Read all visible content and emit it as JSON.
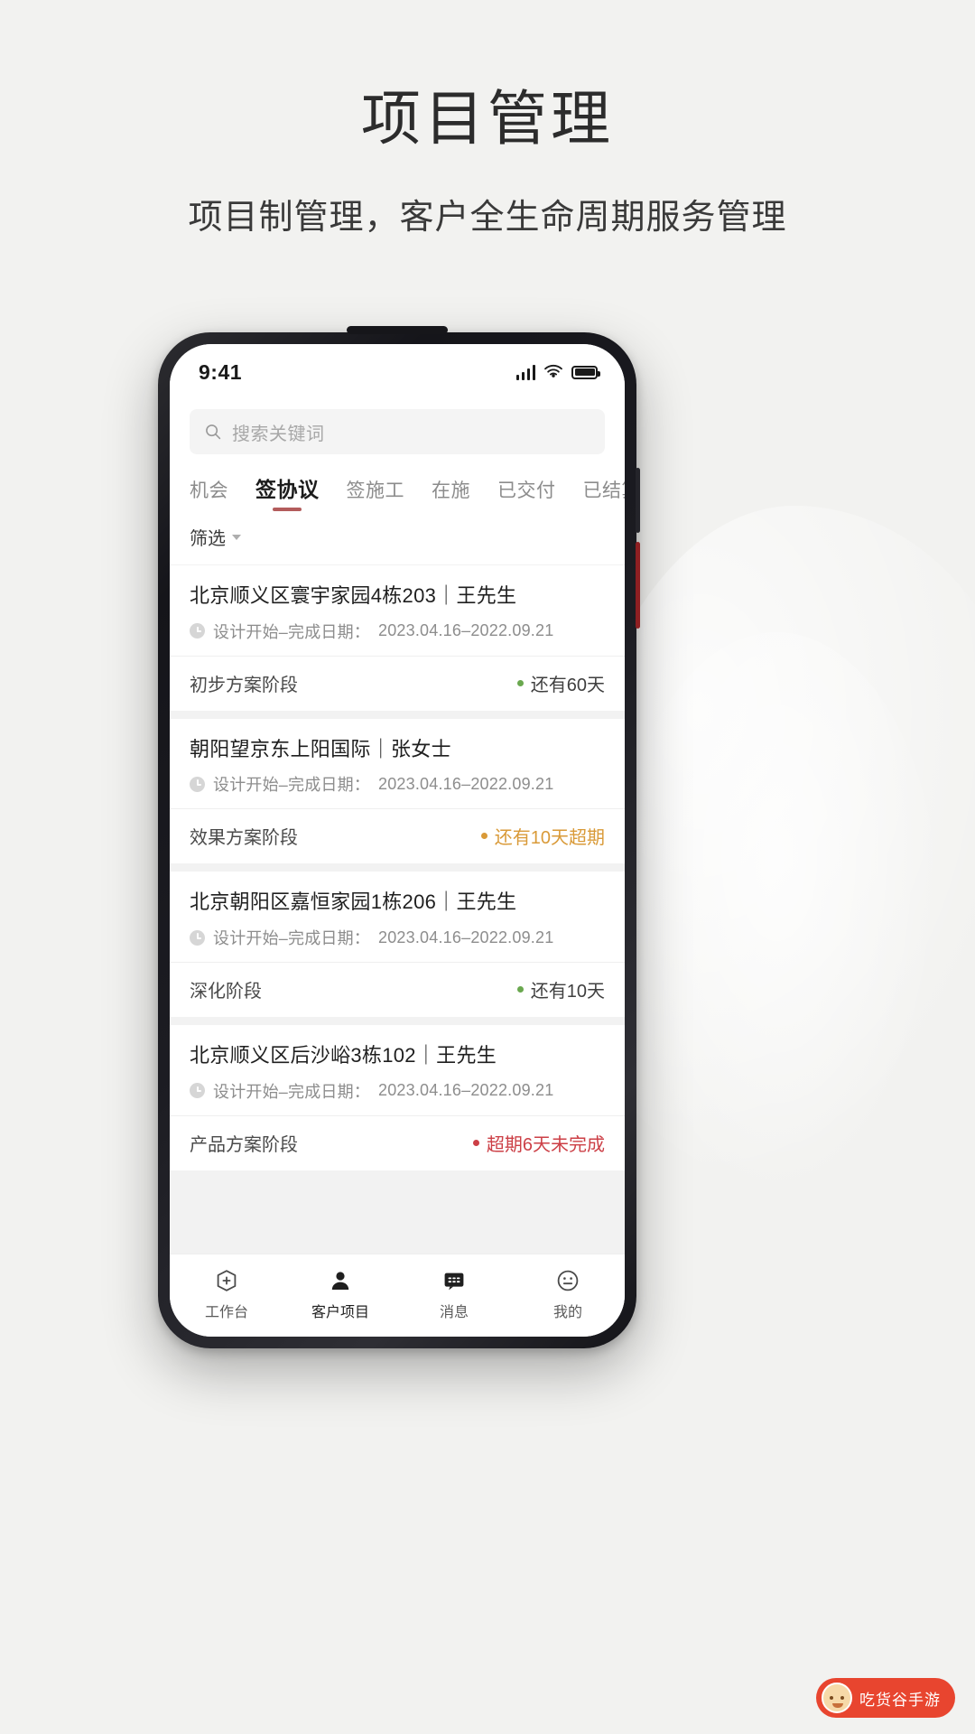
{
  "header": {
    "title": "项目管理",
    "subtitle": "项目制管理，客户全生命周期服务管理"
  },
  "colors": {
    "page_bg": "#f2f2f0",
    "tab_active_underline": "#b35c5c",
    "status_normal": "#6aa84f",
    "status_warn": "#d99a38",
    "status_over": "#cc3f46",
    "watermark_bg": "#e8452f"
  },
  "phone": {
    "statusbar": {
      "time": "9:41",
      "icons": [
        "signal-icon",
        "wifi-icon",
        "battery-icon"
      ]
    },
    "search": {
      "placeholder": "搜索关键词",
      "value": "",
      "icon": "search-icon"
    },
    "tabs": [
      {
        "label": "机会",
        "active": false
      },
      {
        "label": "签协议",
        "active": true
      },
      {
        "label": "签施工",
        "active": false
      },
      {
        "label": "在施",
        "active": false
      },
      {
        "label": "已交付",
        "active": false
      },
      {
        "label": "已结算",
        "active": false
      }
    ],
    "filter": {
      "label": "筛选",
      "icon": "chevron-down-icon"
    },
    "date_label": "设计开始–完成日期：",
    "cards": [
      {
        "title": "北京顺义区寰宇家园4栋203｜王先生",
        "date": "2023.04.16–2022.09.21",
        "stage": "初步方案阶段",
        "remain": "还有60天",
        "remain_state": "normal"
      },
      {
        "title": "朝阳望京东上阳国际｜张女士",
        "date": "2023.04.16–2022.09.21",
        "stage": "效果方案阶段",
        "remain": "还有10天超期",
        "remain_state": "warn"
      },
      {
        "title": "北京朝阳区嘉恒家园1栋206｜王先生",
        "date": "2023.04.16–2022.09.21",
        "stage": "深化阶段",
        "remain": "还有10天",
        "remain_state": "normal"
      },
      {
        "title": "北京顺义区后沙峪3栋102｜王先生",
        "date": "2023.04.16–2022.09.21",
        "stage": "产品方案阶段",
        "remain": "超期6天未完成",
        "remain_state": "over"
      }
    ],
    "bottom_nav": [
      {
        "label": "工作台",
        "icon": "workbench-icon",
        "active": false
      },
      {
        "label": "客户项目",
        "icon": "person-icon",
        "active": true
      },
      {
        "label": "消息",
        "icon": "message-icon",
        "active": false
      },
      {
        "label": "我的",
        "icon": "smiley-icon",
        "active": false
      }
    ]
  },
  "watermark": {
    "text": "吃货谷手游"
  }
}
